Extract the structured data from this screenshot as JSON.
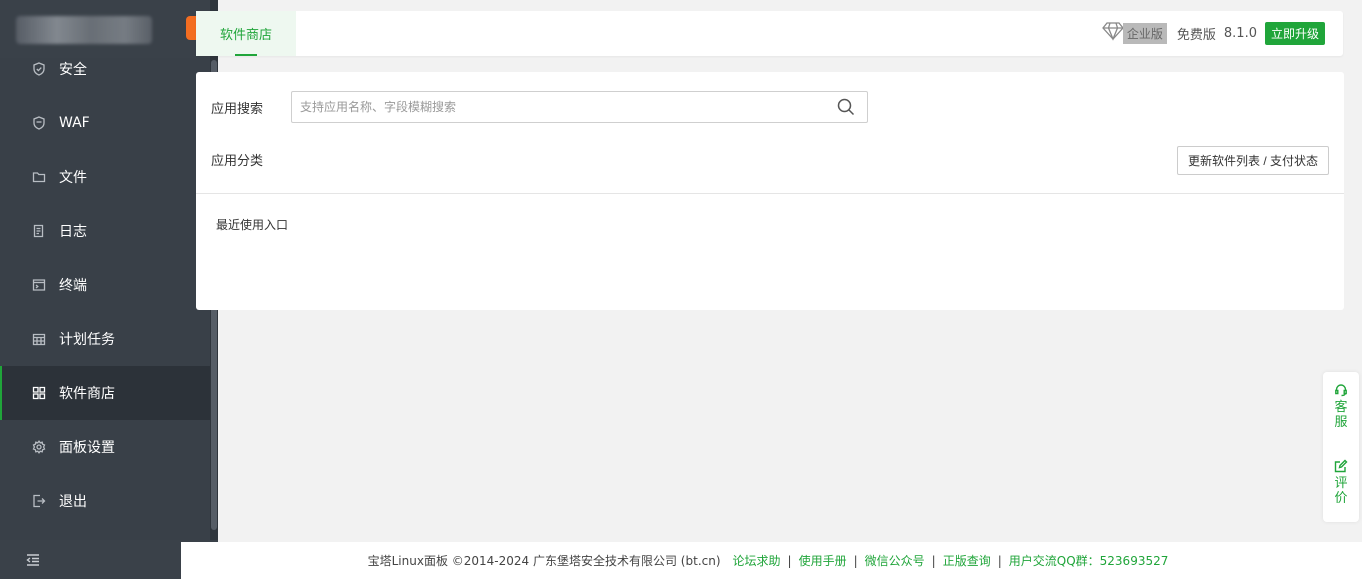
{
  "sidebar": {
    "items": [
      {
        "label": "安全",
        "icon": "shield-icon",
        "active": false
      },
      {
        "label": "WAF",
        "icon": "waf-shield-icon",
        "active": false
      },
      {
        "label": "文件",
        "icon": "folder-icon",
        "active": false
      },
      {
        "label": "日志",
        "icon": "log-icon",
        "active": false
      },
      {
        "label": "终端",
        "icon": "terminal-icon",
        "active": false
      },
      {
        "label": "计划任务",
        "icon": "calendar-icon",
        "active": false
      },
      {
        "label": "软件商店",
        "icon": "grid-icon",
        "active": true
      },
      {
        "label": "面板设置",
        "icon": "gear-icon",
        "active": false
      },
      {
        "label": "退出",
        "icon": "logout-icon",
        "active": false
      }
    ]
  },
  "header": {
    "tab_label": "软件商店",
    "edition_badge": "企业版",
    "free_label": "免费版",
    "version": "8.1.0",
    "upgrade_label": "立即升级"
  },
  "main": {
    "search_label": "应用搜索",
    "search_placeholder": "支持应用名称、字段模糊搜索",
    "search_value": "",
    "category_label": "应用分类",
    "refresh_button": "更新软件列表 / 支付状态",
    "recent_label": "最近使用入口"
  },
  "float": {
    "service_label": "客服",
    "review_label": "评价"
  },
  "footer": {
    "copyright": "宝塔Linux面板 ©2014-2024 广东堡塔安全技术有限公司 (bt.cn)",
    "links": [
      "论坛求助",
      "使用手册",
      "微信公众号",
      "正版查询"
    ],
    "qq_group": "用户交流QQ群：523693527"
  },
  "colors": {
    "accent": "#20a53a",
    "sidebar_bg": "#394048",
    "brand_orange": "#f36d21"
  }
}
